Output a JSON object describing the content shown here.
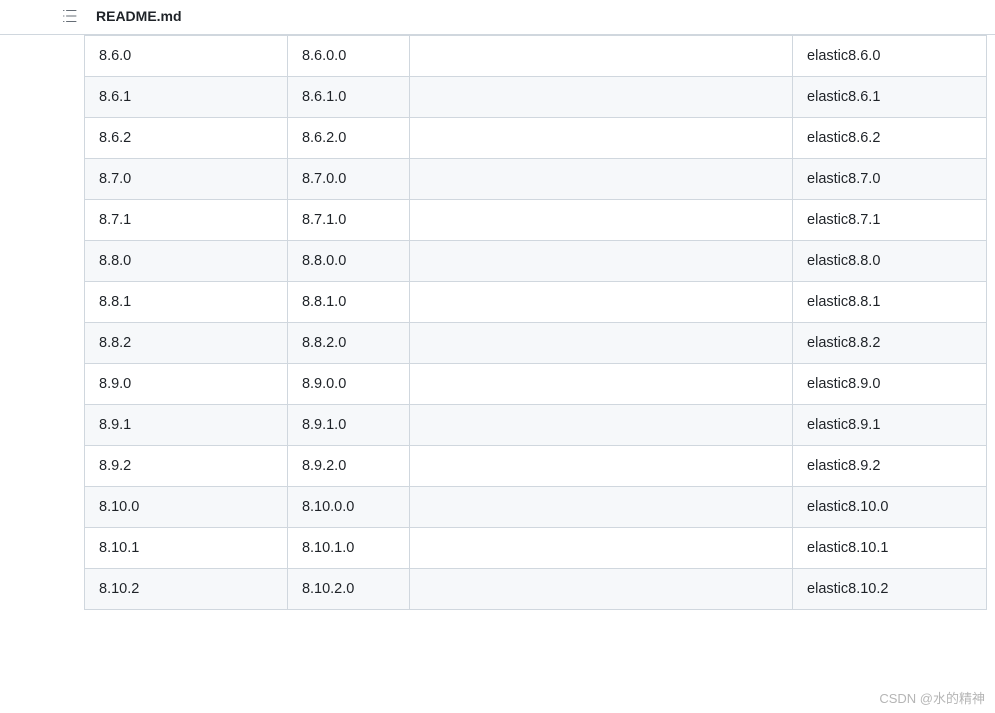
{
  "header": {
    "filename": "README.md"
  },
  "table": {
    "rows": [
      {
        "c0": "8.6.0",
        "c1": "8.6.0.0",
        "c2": "",
        "c3": "elastic8.6.0"
      },
      {
        "c0": "8.6.1",
        "c1": "8.6.1.0",
        "c2": "",
        "c3": "elastic8.6.1"
      },
      {
        "c0": "8.6.2",
        "c1": "8.6.2.0",
        "c2": "",
        "c3": "elastic8.6.2"
      },
      {
        "c0": "8.7.0",
        "c1": "8.7.0.0",
        "c2": "",
        "c3": "elastic8.7.0"
      },
      {
        "c0": "8.7.1",
        "c1": "8.7.1.0",
        "c2": "",
        "c3": "elastic8.7.1"
      },
      {
        "c0": "8.8.0",
        "c1": "8.8.0.0",
        "c2": "",
        "c3": "elastic8.8.0"
      },
      {
        "c0": "8.8.1",
        "c1": "8.8.1.0",
        "c2": "",
        "c3": "elastic8.8.1"
      },
      {
        "c0": "8.8.2",
        "c1": "8.8.2.0",
        "c2": "",
        "c3": "elastic8.8.2"
      },
      {
        "c0": "8.9.0",
        "c1": "8.9.0.0",
        "c2": "",
        "c3": "elastic8.9.0"
      },
      {
        "c0": "8.9.1",
        "c1": "8.9.1.0",
        "c2": "",
        "c3": "elastic8.9.1"
      },
      {
        "c0": "8.9.2",
        "c1": "8.9.2.0",
        "c2": "",
        "c3": "elastic8.9.2"
      },
      {
        "c0": "8.10.0",
        "c1": "8.10.0.0",
        "c2": "",
        "c3": "elastic8.10.0"
      },
      {
        "c0": "8.10.1",
        "c1": "8.10.1.0",
        "c2": "",
        "c3": "elastic8.10.1"
      },
      {
        "c0": "8.10.2",
        "c1": "8.10.2.0",
        "c2": "",
        "c3": "elastic8.10.2"
      }
    ]
  },
  "watermark": "CSDN @水的精神"
}
